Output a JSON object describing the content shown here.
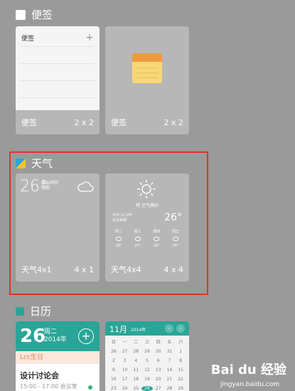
{
  "sections": {
    "memo": {
      "title": "便签",
      "icon_color": "#ffffff",
      "cards": [
        {
          "preview_title": "便签",
          "preview_plus": "+",
          "label": "便签",
          "size": "2 x 2"
        },
        {
          "label": "便签",
          "size": "2 x 2"
        }
      ]
    },
    "weather": {
      "title": "天气",
      "icon_color": "#2aa5d9",
      "cards": [
        {
          "temp": "26°",
          "sub_lines": [
            "多云转阴",
            "晴朗"
          ],
          "label": "天气4x1",
          "size": "4 x 1"
        },
        {
          "desc": "晴 空气质好",
          "small": [
            "今日 12-28°",
            "多云转晴"
          ],
          "temp": "26°",
          "forecast": [
            {
              "day": "周二",
              "temp": "28°"
            },
            {
              "day": "周三",
              "temp": "27°"
            },
            {
              "day": "周四",
              "temp": "26°"
            },
            {
              "day": "周五",
              "temp": "25°"
            }
          ],
          "label": "天气4x4",
          "size": "4 x 4"
        }
      ]
    },
    "calendar": {
      "title": "日历",
      "icon_color": "#2aa597",
      "card1": {
        "date": "26",
        "weekday": "周二",
        "year": "2014年",
        "add": "+",
        "birthday": "Lcc生日",
        "event_title": "设计讨论会",
        "event_time": "15:00 - 17:00 会议室"
      },
      "card2": {
        "month": "11月",
        "mini": "2014年",
        "prev": "‹",
        "next": "›",
        "days": [
          "日",
          "一",
          "二",
          "三",
          "四",
          "五",
          "六",
          "26",
          "27",
          "28",
          "29",
          "30",
          "31",
          "1",
          "2",
          "3",
          "4",
          "5",
          "6",
          "7",
          "8",
          "9",
          "10",
          "11",
          "12",
          "13",
          "14",
          "15",
          "16",
          "17",
          "18",
          "19",
          "20",
          "21",
          "22",
          "23",
          "24",
          "25",
          "26",
          "27",
          "28",
          "29"
        ]
      }
    }
  },
  "watermark": {
    "brand": "Bai du 经验",
    "url": "jingyan.baidu.com"
  },
  "colors": {
    "background": "#9a9a9a",
    "highlight": "#e0332b",
    "accent": "#2aa597"
  }
}
